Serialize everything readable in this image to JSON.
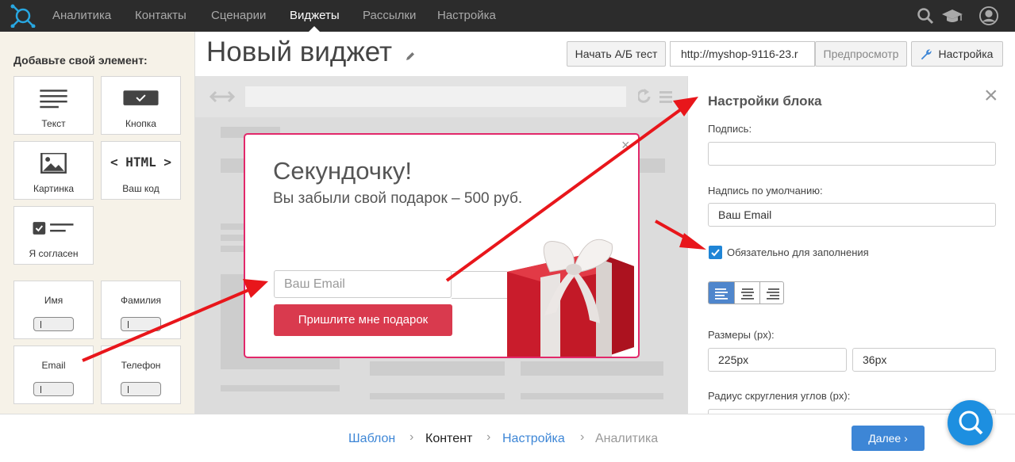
{
  "nav": {
    "items": [
      "Аналитика",
      "Контакты",
      "Сценарии",
      "Виджеты",
      "Рассылки",
      "Настройка"
    ],
    "active": "Виджеты"
  },
  "sidebar": {
    "title": "Добавьте свой элемент:",
    "tiles": [
      {
        "label": "Текст",
        "icon": "text-lines-icon"
      },
      {
        "label": "Кнопка",
        "icon": "button-check-icon"
      },
      {
        "label": "Картинка",
        "icon": "image-icon"
      },
      {
        "label": "Ваш код",
        "icon": "html-code-icon",
        "icon_text": "< HTML >"
      },
      {
        "label": "Я согласен",
        "icon": "checkbox-agree-icon"
      },
      {
        "label": "Имя"
      },
      {
        "label": "Фамилия"
      },
      {
        "label": "Email"
      },
      {
        "label": "Телефон"
      }
    ]
  },
  "header": {
    "title": "Новый виджет",
    "ab_test_label": "Начать А/Б тест",
    "url_value": "http://myshop-9116-23.r",
    "preview_label": "Предпросмотр",
    "settings_label": "Настройка"
  },
  "popup": {
    "title": "Секундочку!",
    "subtitle": "Вы забыли свой подарок – 500 руб.",
    "email_placeholder": "Ваш Email",
    "button_label": "Пришлите мне подарок",
    "close": "×"
  },
  "settings": {
    "title": "Настройки блока",
    "caption_label": "Подпись:",
    "caption_value": "",
    "default_label": "Надпись по умолчанию:",
    "default_value": "Ваш Email",
    "required_label": "Обязательно для заполнения",
    "required_checked": true,
    "size_label": "Размеры (px):",
    "width_value": "225px",
    "height_value": "36px",
    "radius_label": "Радиус скругления углов (px):"
  },
  "footer": {
    "steps": [
      "Шаблон",
      "Контент",
      "Настройка",
      "Аналитика"
    ],
    "next_label": "Далее"
  },
  "colors": {
    "topbar": "#2c2c2c",
    "accent": "#3d86d6",
    "popup_border": "#e2286a",
    "popup_button": "#d93a4e",
    "arrow": "#e8161b"
  }
}
